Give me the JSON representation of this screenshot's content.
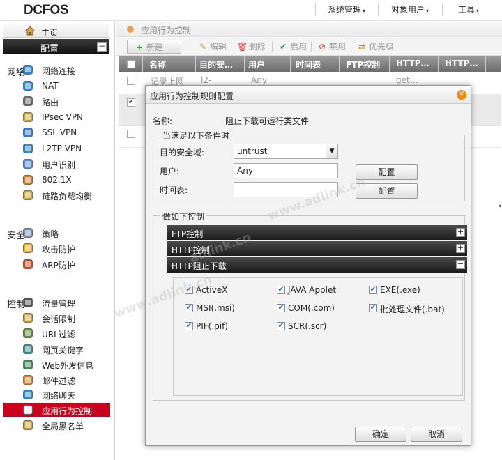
{
  "app": {
    "logo": "DCFOS",
    "menus": [
      {
        "label": "系统管理"
      },
      {
        "label": "对象用户"
      },
      {
        "label": "工具"
      }
    ]
  },
  "sidebar": {
    "home": "主页",
    "config": "配置",
    "config_toggle": "−",
    "sections": [
      {
        "title": "网络",
        "items": [
          {
            "label": "网络连接",
            "icon": "globe-icon"
          },
          {
            "label": "NAT",
            "icon": "nat-globe-icon"
          },
          {
            "label": "路由",
            "icon": "router-icon"
          },
          {
            "label": "IPsec VPN",
            "icon": "vpn-icon"
          },
          {
            "label": "SSL VPN",
            "icon": "ssl-vpn-icon"
          },
          {
            "label": "L2TP VPN",
            "icon": "l2tp-icon"
          },
          {
            "label": "用户识别",
            "icon": "user-id-icon"
          },
          {
            "label": "802.1X",
            "icon": "dot1x-icon"
          },
          {
            "label": "链路负载均衡",
            "icon": "load-balance-icon"
          }
        ]
      },
      {
        "title": "安全",
        "items": [
          {
            "label": "策略",
            "icon": "policy-icon"
          },
          {
            "label": "攻击防护",
            "icon": "shield-icon"
          },
          {
            "label": "ARP防护",
            "icon": "arp-icon"
          }
        ]
      },
      {
        "title": "控制",
        "items": [
          {
            "label": "流量管理",
            "icon": "traffic-icon"
          },
          {
            "label": "会话限制",
            "icon": "session-icon"
          },
          {
            "label": "URL过滤",
            "icon": "url-filter-icon"
          },
          {
            "label": "网页关键字",
            "icon": "keyword-icon"
          },
          {
            "label": "Web外发信息",
            "icon": "web-post-icon"
          },
          {
            "label": "邮件过滤",
            "icon": "mail-icon"
          },
          {
            "label": "网络聊天",
            "icon": "chat-icon"
          },
          {
            "label": "应用行为控制",
            "icon": "app-control-icon",
            "active": true
          },
          {
            "label": "全局黑名单",
            "icon": "blacklist-icon"
          }
        ]
      }
    ]
  },
  "main": {
    "breadcrumb": "应用行为控制",
    "toolbar": {
      "new": "新建",
      "edit": "编辑",
      "delete": "删除",
      "enable": "启用",
      "disable": "禁用",
      "priority": "优先级"
    },
    "columns": [
      "名称",
      "目的安…",
      "用户",
      "时间表",
      "FTP控制",
      "HTTP…",
      "HTTP…"
    ],
    "rows": [
      {
        "name": "记录上网",
        "zone": "l2-",
        "user": "Any",
        "http": "get…"
      }
    ]
  },
  "dialog": {
    "title": "应用行为控制规则配置",
    "name_label": "名称:",
    "name_value": "阻止下载可运行类文件",
    "conditions_legend": "当满足以下条件时",
    "zone_label": "目的安全域:",
    "zone_value": "untrust",
    "user_label": "用户:",
    "user_value": "Any",
    "schedule_label": "时间表:",
    "schedule_value": "",
    "config_button": "配置",
    "actions_legend": "做如下控制",
    "sections": [
      {
        "label": "FTP控制",
        "toggle": "+"
      },
      {
        "label": "HTTP控制",
        "toggle": "+"
      },
      {
        "label": "HTTP阻止下载",
        "toggle": "−"
      }
    ],
    "file_types": [
      {
        "label": "ActiveX",
        "checked": true
      },
      {
        "label": "JAVA Applet",
        "checked": true
      },
      {
        "label": "EXE(.exe)",
        "checked": true
      },
      {
        "label": "MSI(.msi)",
        "checked": true
      },
      {
        "label": "COM(.com)",
        "checked": true
      },
      {
        "label": "批处理文件(.bat)",
        "checked": true
      },
      {
        "label": "PIF(.pif)",
        "checked": true
      },
      {
        "label": "SCR(.scr)",
        "checked": true
      }
    ],
    "ok": "确定",
    "cancel": "取消"
  },
  "watermarks": [
    "www.adlink.cn",
    "adlink.cn",
    "www.adlink.cn"
  ]
}
